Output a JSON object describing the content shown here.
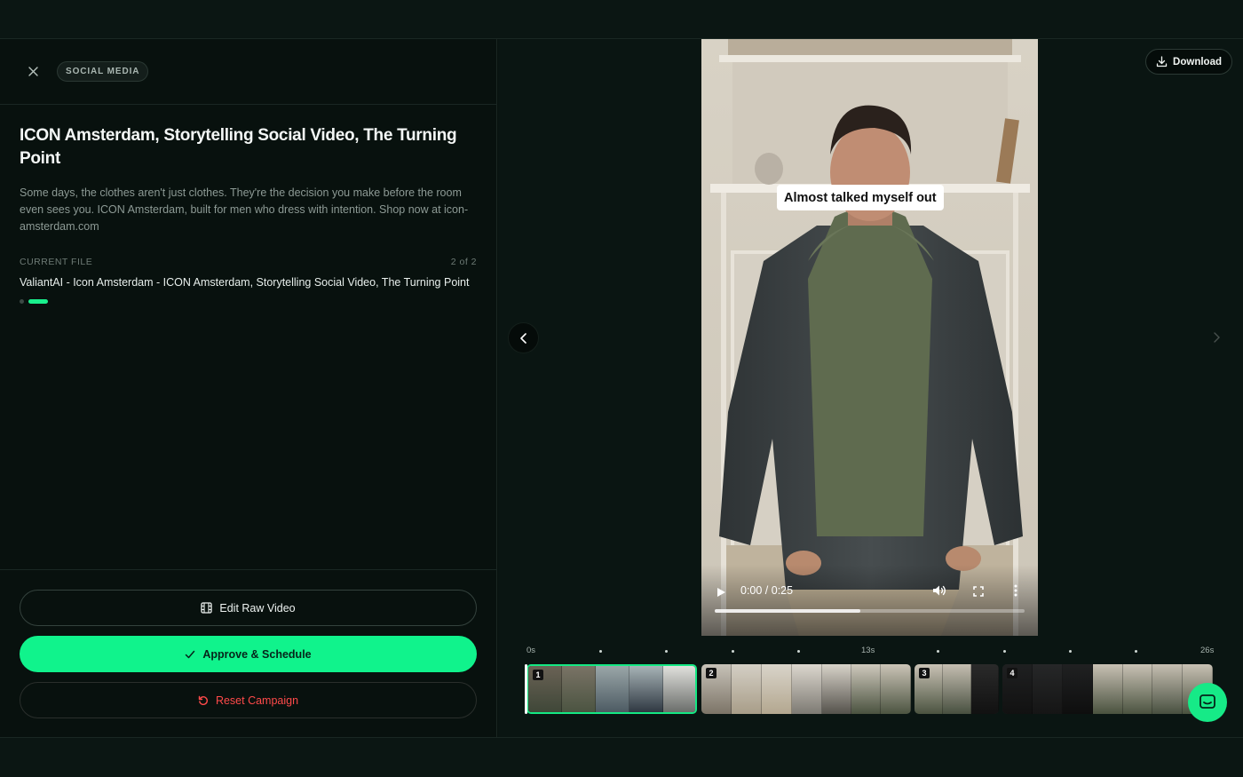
{
  "header": {
    "tag": "SOCIAL MEDIA"
  },
  "campaign": {
    "title": "ICON Amsterdam, Storytelling Social Video, The Turning Point",
    "description": "Some days, the clothes aren't just clothes. They're the decision you make before the room even sees you. ICON Amsterdam, built for men who dress with intention. Shop now at icon-amsterdam.com",
    "current_file_label": "CURRENT FILE",
    "file_count": "2 of 2",
    "file_name": "ValiantAI - Icon Amsterdam - ICON Amsterdam, Storytelling Social Video, The Turning Point",
    "file_index": 2,
    "file_total": 2
  },
  "actions": {
    "edit_label": "Edit Raw Video",
    "approve_label": "Approve & Schedule",
    "reset_label": "Reset Campaign"
  },
  "player": {
    "download_label": "Download",
    "caption": "Almost talked myself out",
    "time": "0:00 / 0:25",
    "progress": 0.47
  },
  "timeline": {
    "start_label": "0s",
    "mid_label": "13s",
    "end_label": "26s",
    "clips": [
      {
        "num": "1",
        "active": true
      },
      {
        "num": "2",
        "active": false
      },
      {
        "num": "3",
        "active": false
      },
      {
        "num": "4",
        "active": false
      }
    ]
  },
  "colors": {
    "accent": "#10f38c",
    "danger": "#ff4a4a",
    "background": "#08110e"
  }
}
